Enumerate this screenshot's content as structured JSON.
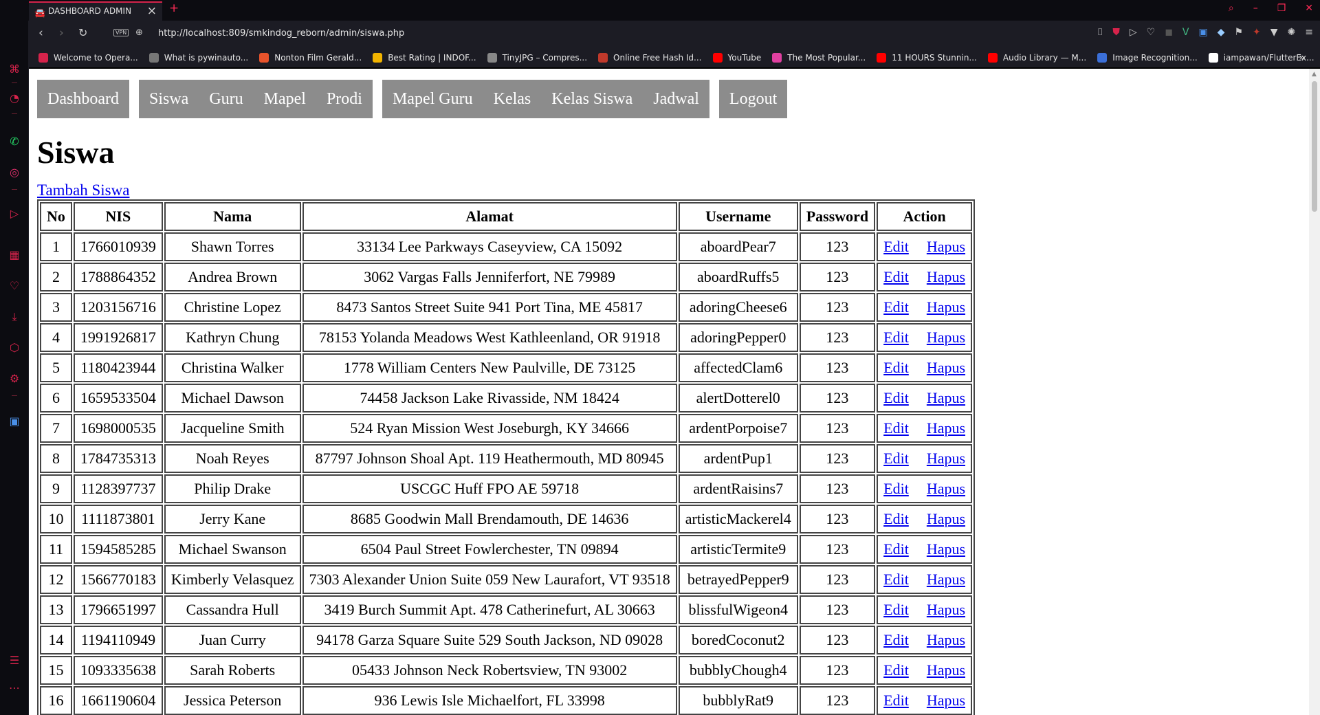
{
  "browser": {
    "tab_title": "DASHBOARD ADMIN",
    "url": "http://localhost:809/smkindog_reborn/admin/siswa.php",
    "vpn_label": "VPN",
    "bookmarks": [
      {
        "label": "Welcome to Opera...",
        "color": "#d6234b"
      },
      {
        "label": "What is pywinauto...",
        "color": "#777777"
      },
      {
        "label": "Nonton Film Gerald...",
        "color": "#e8532b"
      },
      {
        "label": "Best Rating | INDOF...",
        "color": "#f2b400"
      },
      {
        "label": "TinyJPG – Compres...",
        "color": "#888888"
      },
      {
        "label": "Online Free Hash Id...",
        "color": "#c0392b"
      },
      {
        "label": "YouTube",
        "color": "#ff0000"
      },
      {
        "label": "The Most Popular...",
        "color": "#e040a0"
      },
      {
        "label": "11 HOURS Stunnin...",
        "color": "#ff0000"
      },
      {
        "label": "Audio Library — M...",
        "color": "#ff0000"
      },
      {
        "label": "Image Recognition...",
        "color": "#3b6fd8"
      },
      {
        "label": "iampawan/FlutterEx...",
        "color": "#ffffff"
      }
    ]
  },
  "nav": {
    "group1": [
      "Dashboard"
    ],
    "group2": [
      "Siswa",
      "Guru",
      "Mapel",
      "Prodi"
    ],
    "group3": [
      "Mapel Guru",
      "Kelas",
      "Kelas Siswa",
      "Jadwal"
    ],
    "group4": [
      "Logout"
    ]
  },
  "page_title": "Siswa",
  "add_link": "Tambah Siswa",
  "table": {
    "headers": [
      "No",
      "NIS",
      "Nama",
      "Alamat",
      "Username",
      "Password",
      "Action"
    ],
    "edit_label": "Edit",
    "delete_label": "Hapus",
    "rows": [
      [
        "1",
        "1766010939",
        "Shawn Torres",
        "33134 Lee Parkways Caseyview, CA 15092",
        "aboardPear7",
        "123"
      ],
      [
        "2",
        "1788864352",
        "Andrea Brown",
        "3062 Vargas Falls Jenniferfort, NE 79989",
        "aboardRuffs5",
        "123"
      ],
      [
        "3",
        "1203156716",
        "Christine Lopez",
        "8473 Santos Street Suite 941 Port Tina, ME 45817",
        "adoringCheese6",
        "123"
      ],
      [
        "4",
        "1991926817",
        "Kathryn Chung",
        "78153 Yolanda Meadows West Kathleenland, OR 91918",
        "adoringPepper0",
        "123"
      ],
      [
        "5",
        "1180423944",
        "Christina Walker",
        "1778 William Centers New Paulville, DE 73125",
        "affectedClam6",
        "123"
      ],
      [
        "6",
        "1659533504",
        "Michael Dawson",
        "74458 Jackson Lake Rivasside, NM 18424",
        "alertDotterel0",
        "123"
      ],
      [
        "7",
        "1698000535",
        "Jacqueline Smith",
        "524 Ryan Mission West Joseburgh, KY 34666",
        "ardentPorpoise7",
        "123"
      ],
      [
        "8",
        "1784735313",
        "Noah Reyes",
        "87797 Johnson Shoal Apt. 119 Heathermouth, MD 80945",
        "ardentPup1",
        "123"
      ],
      [
        "9",
        "1128397737",
        "Philip Drake",
        "USCGC Huff FPO AE 59718",
        "ardentRaisins7",
        "123"
      ],
      [
        "10",
        "1111873801",
        "Jerry Kane",
        "8685 Goodwin Mall Brendamouth, DE 14636",
        "artisticMackerel4",
        "123"
      ],
      [
        "11",
        "1594585285",
        "Michael Swanson",
        "6504 Paul Street Fowlerchester, TN 09894",
        "artisticTermite9",
        "123"
      ],
      [
        "12",
        "1566770183",
        "Kimberly Velasquez",
        "7303 Alexander Union Suite 059 New Laurafort, VT 93518",
        "betrayedPepper9",
        "123"
      ],
      [
        "13",
        "1796651997",
        "Cassandra Hull",
        "3419 Burch Summit Apt. 478 Catherinefurt, AL 30663",
        "blissfulWigeon4",
        "123"
      ],
      [
        "14",
        "1194110949",
        "Juan Curry",
        "94178 Garza Square Suite 529 South Jackson, ND 09028",
        "boredCoconut2",
        "123"
      ],
      [
        "15",
        "1093335638",
        "Sarah Roberts",
        "05433 Johnson Neck Robertsview, TN 93002",
        "bubblyChough4",
        "123"
      ],
      [
        "16",
        "1661190604",
        "Jessica Peterson",
        "936 Lewis Isle Michaelfort, FL 33998",
        "bubblyRat9",
        "123"
      ]
    ]
  }
}
